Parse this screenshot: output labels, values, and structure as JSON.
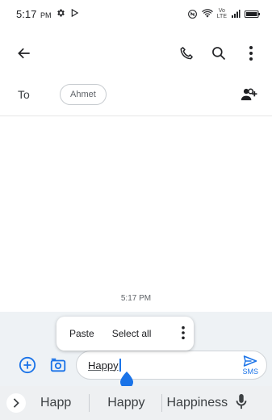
{
  "status_bar": {
    "time": "5:17",
    "ampm": "PM",
    "lte_top": "Vo",
    "lte_bottom": "LTE"
  },
  "app_bar": {
    "back_icon": "arrow-left-icon",
    "call_icon": "phone-icon",
    "search_icon": "search-icon",
    "more_icon": "more-vert-icon"
  },
  "recipient": {
    "to_label": "To",
    "chip": "Ahmet",
    "add_icon": "add-people-icon"
  },
  "conversation": {
    "timestamp": "5:17 PM"
  },
  "context_menu": {
    "paste": "Paste",
    "select_all": "Select all",
    "more_icon": "more-vert-icon"
  },
  "compose": {
    "attach_icon": "plus-circle-icon",
    "camera_icon": "camera-icon",
    "text": "Happy",
    "send_label": "SMS",
    "send_icon": "send-icon"
  },
  "suggestions": {
    "expand_icon": "chevron-right-icon",
    "items": [
      "Happ",
      "Happy",
      "Happiness"
    ],
    "mic_icon": "mic-icon"
  },
  "colors": {
    "accent": "#1a73e8",
    "compose_bg": "#eef2f5"
  }
}
